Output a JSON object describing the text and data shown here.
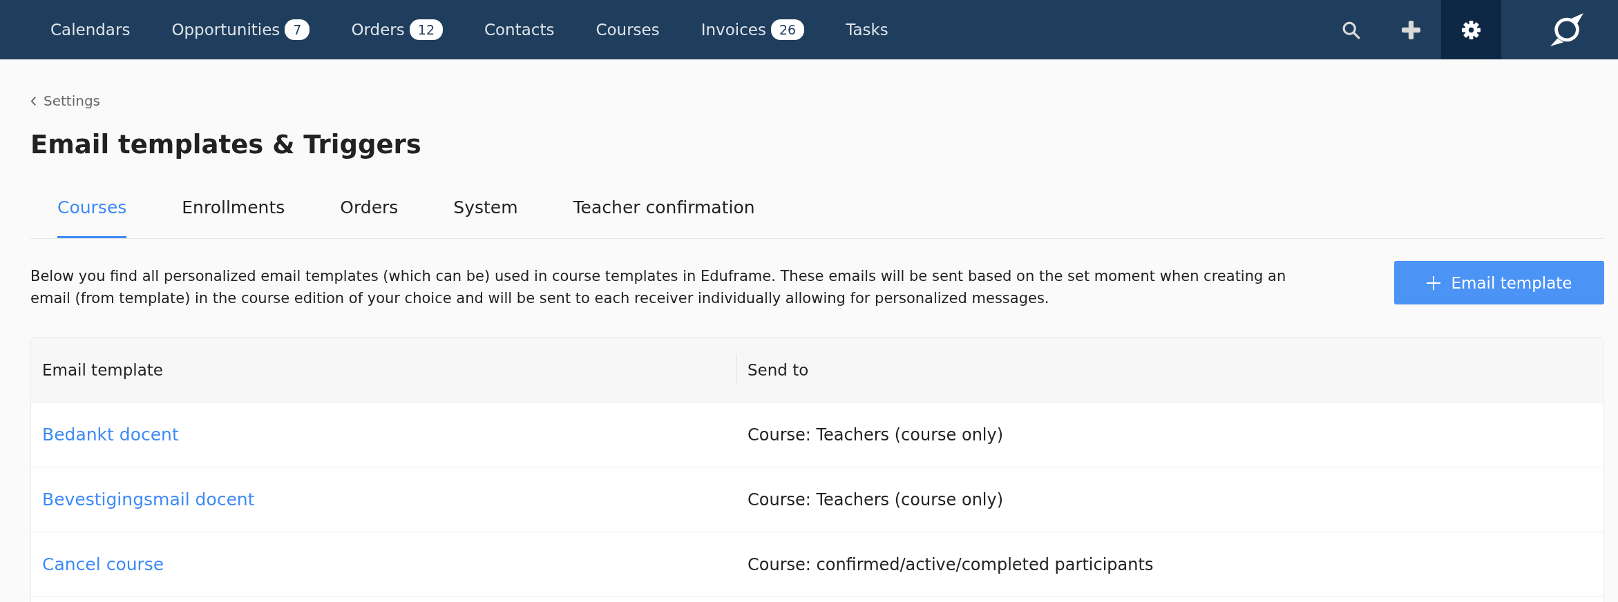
{
  "nav": {
    "items": [
      {
        "label": "Calendars",
        "selected": false
      },
      {
        "label": "Opportunities",
        "badge": "7",
        "selected": false
      },
      {
        "label": "Orders",
        "badge": "12",
        "selected": false
      },
      {
        "label": "Contacts",
        "selected": false
      },
      {
        "label": "Courses",
        "selected": false
      },
      {
        "label": "Invoices",
        "badge": "26",
        "selected": false
      },
      {
        "label": "Tasks",
        "selected": false
      }
    ],
    "tools": [
      {
        "kind": "search",
        "selected": false
      },
      {
        "kind": "add",
        "selected": false
      },
      {
        "kind": "settings",
        "selected": true
      }
    ]
  },
  "breadcrumb": {
    "label": "Settings"
  },
  "title": "Email templates & Triggers",
  "tabs": [
    {
      "label": "Courses",
      "selected": true
    },
    {
      "label": "Enrollments",
      "selected": false
    },
    {
      "label": "Orders",
      "selected": false
    },
    {
      "label": "System",
      "selected": false
    },
    {
      "label": "Teacher confirmation",
      "selected": false
    }
  ],
  "description": "Below you find all personalized email templates (which can be) used in course templates in Eduframe. These emails will be sent based on the set moment when creating an email (from template) in the course edition of your choice and will be sent to each receiver individually allowing for personalized messages.",
  "add_button": {
    "label": "Email template"
  },
  "table": {
    "columns": [
      "Email template",
      "Send to"
    ],
    "rows": [
      {
        "email_template": "Bedankt docent",
        "send_to": "Course: Teachers (course only)"
      },
      {
        "email_template": "Bevestigingsmail docent",
        "send_to": "Course: Teachers (course only)"
      },
      {
        "email_template": "Cancel course",
        "send_to": "Course: confirmed/active/completed participants"
      }
    ]
  }
}
